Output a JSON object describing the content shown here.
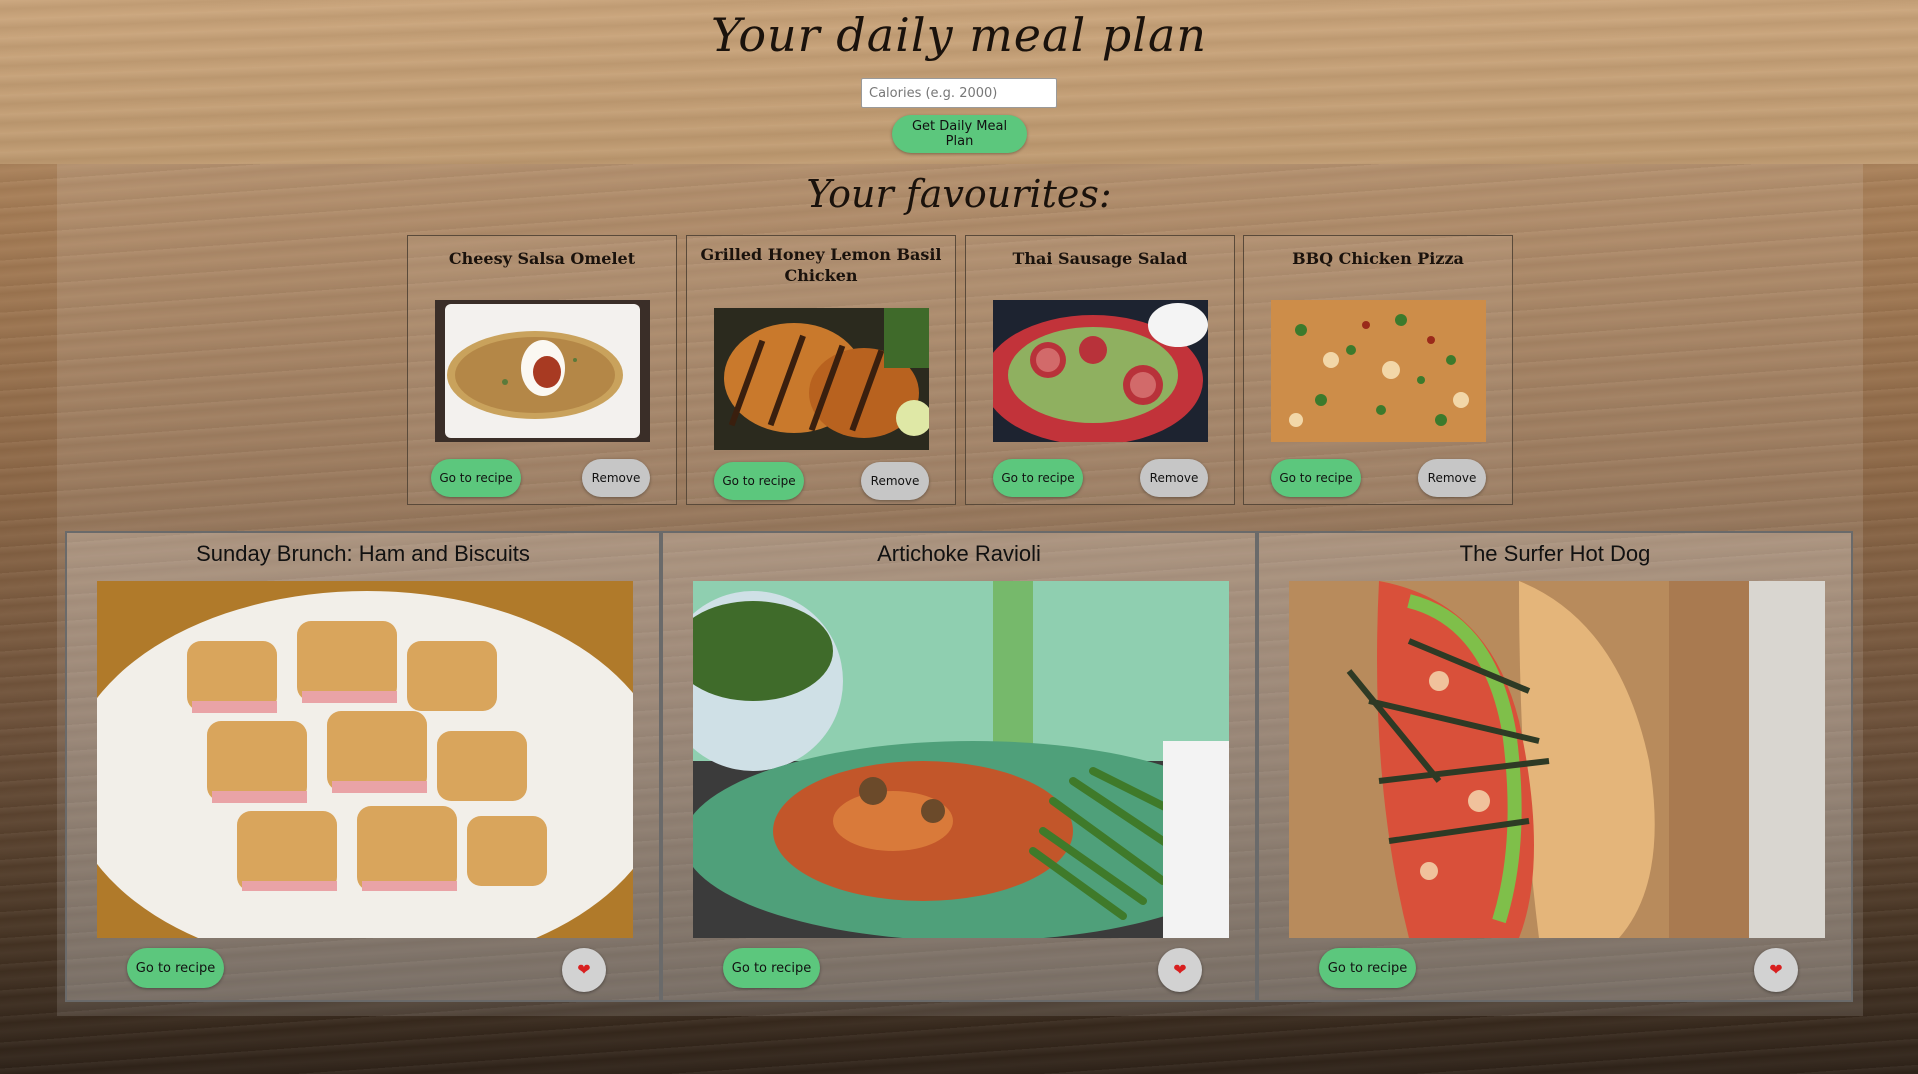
{
  "header": {
    "title": "Your daily meal plan",
    "calories_placeholder": "Calories (e.g. 2000)",
    "calories_value": "",
    "get_plan_label": "Get Daily Meal Plan"
  },
  "favourites": {
    "heading": "Your favourites:",
    "items": [
      {
        "title": "Cheesy Salsa Omelet",
        "go_label": "Go to recipe",
        "remove_label": "Remove"
      },
      {
        "title": "Grilled Honey Lemon Basil Chicken",
        "go_label": "Go to recipe",
        "remove_label": "Remove"
      },
      {
        "title": "Thai Sausage Salad",
        "go_label": "Go to recipe",
        "remove_label": "Remove"
      },
      {
        "title": "BBQ Chicken Pizza",
        "go_label": "Go to recipe",
        "remove_label": "Remove"
      }
    ]
  },
  "meals": [
    {
      "title": "Sunday Brunch: Ham and Biscuits",
      "go_label": "Go to recipe",
      "icon": "heart-icon"
    },
    {
      "title": "Artichoke Ravioli",
      "go_label": "Go to recipe",
      "icon": "heart-icon"
    },
    {
      "title": "The Surfer Hot Dog",
      "go_label": "Go to recipe",
      "icon": "heart-icon"
    }
  ],
  "colors": {
    "button_green": "#5cc77d",
    "button_grey": "#c6c6c6",
    "heart_red": "#d81f1f"
  }
}
